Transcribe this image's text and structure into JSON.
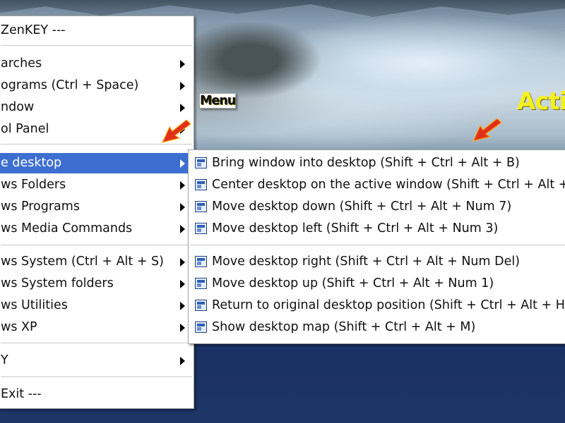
{
  "annotations": {
    "menu_label": "Menu",
    "action_label": "Acti"
  },
  "main_menu": {
    "items": [
      {
        "label": "ZenKEY   ---",
        "has_submenu": false
      },
      {
        "label": "arches",
        "has_submenu": true
      },
      {
        "label": "ograms (Ctrl + Space)",
        "has_submenu": true
      },
      {
        "label": "ndow",
        "has_submenu": true
      },
      {
        "label": "ol Panel",
        "has_submenu": true
      },
      {
        "label": "e desktop",
        "has_submenu": true,
        "highlighted": true
      },
      {
        "label": "ws Folders",
        "has_submenu": true
      },
      {
        "label": "ws Programs",
        "has_submenu": true
      },
      {
        "label": "ws Media Commands",
        "has_submenu": true
      },
      {
        "label": "ws System (Ctrl + Alt + S)",
        "has_submenu": true
      },
      {
        "label": "ws System folders",
        "has_submenu": true
      },
      {
        "label": "ws Utilities",
        "has_submenu": true
      },
      {
        "label": "ws XP",
        "has_submenu": true
      },
      {
        "label": "Y",
        "has_submenu": true
      },
      {
        "label": "Exit   ---",
        "has_submenu": false
      }
    ]
  },
  "desktop_submenu": {
    "icon": "window-icon",
    "items": [
      {
        "label": "Bring window into desktop (Shift + Ctrl + Alt + B)"
      },
      {
        "label": "Center desktop on the active window (Shift + Ctrl + Alt + C)"
      },
      {
        "label": "Move desktop down (Shift + Ctrl + Alt + Num 7)"
      },
      {
        "label": "Move desktop left (Shift + Ctrl + Alt + Num 3)"
      },
      {
        "label": "Move desktop right (Shift + Ctrl + Alt + Num Del)"
      },
      {
        "label": "Move desktop up (Shift + Ctrl + Alt + Num 1)"
      },
      {
        "label": "Return to original desktop position (Shift + Ctrl + Alt + H)"
      },
      {
        "label": "Show desktop map (Shift + Ctrl + Alt + M)"
      }
    ]
  },
  "colors": {
    "highlight": "#3d6fd0",
    "annotation_yellow": "#f4f020",
    "arrow_red": "#e0301a"
  }
}
